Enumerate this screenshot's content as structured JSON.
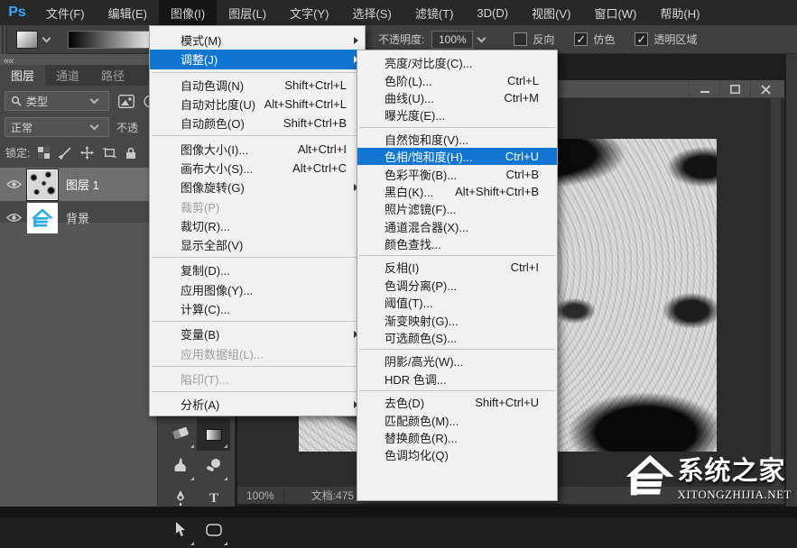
{
  "menu_bar": {
    "logo": "Ps",
    "items": [
      {
        "key": "file",
        "label": "文件(F)"
      },
      {
        "key": "edit",
        "label": "编辑(E)"
      },
      {
        "key": "image",
        "label": "图像(I)",
        "active": true
      },
      {
        "key": "layer",
        "label": "图层(L)"
      },
      {
        "key": "type",
        "label": "文字(Y)"
      },
      {
        "key": "select",
        "label": "选择(S)"
      },
      {
        "key": "filter",
        "label": "滤镜(T)"
      },
      {
        "key": "3d",
        "label": "3D(D)"
      },
      {
        "key": "view",
        "label": "视图(V)"
      },
      {
        "key": "window",
        "label": "窗口(W)"
      },
      {
        "key": "help",
        "label": "帮助(H)"
      }
    ]
  },
  "options_bar": {
    "opacity_label": "不透明度:",
    "opacity_value": "100%",
    "checkboxes": [
      {
        "key": "reverse",
        "label": "反向",
        "checked": false
      },
      {
        "key": "dither",
        "label": "仿色",
        "checked": true
      },
      {
        "key": "transparency",
        "label": "透明区域",
        "checked": true
      }
    ]
  },
  "panels": {
    "tabs": [
      {
        "key": "layers",
        "label": "图层",
        "active": true
      },
      {
        "key": "channels",
        "label": "通道",
        "active": false
      },
      {
        "key": "paths",
        "label": "路径",
        "active": false
      }
    ],
    "filter_label": "类型",
    "blend_mode": "正常",
    "opacity_partial": "不透",
    "lock_label": "锁定:",
    "lock_icons": [
      "lock-transparent-icon",
      "lock-brush-icon",
      "lock-move-icon",
      "lock-artboard-icon",
      "lock-all-icon"
    ],
    "layers": [
      {
        "name": "图层 1",
        "selected": true,
        "thumb": "texture"
      },
      {
        "name": "背景",
        "selected": false,
        "thumb": "logo"
      }
    ]
  },
  "tools": [
    {
      "key": "eraser",
      "selected": false
    },
    {
      "key": "gradient",
      "selected": true
    },
    {
      "key": "smudge",
      "selected": false
    },
    {
      "key": "dodge",
      "selected": false
    },
    {
      "key": "pen",
      "selected": false
    },
    {
      "key": "type",
      "selected": false
    },
    {
      "key": "path-select",
      "selected": false
    },
    {
      "key": "shape",
      "selected": false
    }
  ],
  "image_menu": {
    "items": [
      {
        "key": "mode",
        "label": "模式(M)",
        "submenu": true
      },
      {
        "key": "adjustments",
        "label": "调整(J)",
        "submenu": true,
        "highlighted": true
      },
      {
        "type": "separator"
      },
      {
        "key": "auto-tone",
        "label": "自动色调(N)",
        "shortcut": "Shift+Ctrl+L"
      },
      {
        "key": "auto-contrast",
        "label": "自动对比度(U)",
        "shortcut": "Alt+Shift+Ctrl+L"
      },
      {
        "key": "auto-color",
        "label": "自动颜色(O)",
        "shortcut": "Shift+Ctrl+B"
      },
      {
        "type": "separator"
      },
      {
        "key": "image-size",
        "label": "图像大小(I)...",
        "shortcut": "Alt+Ctrl+I"
      },
      {
        "key": "canvas-size",
        "label": "画布大小(S)...",
        "shortcut": "Alt+Ctrl+C"
      },
      {
        "key": "image-rotation",
        "label": "图像旋转(G)",
        "submenu": true
      },
      {
        "key": "crop",
        "label": "裁剪(P)",
        "disabled": true
      },
      {
        "key": "trim",
        "label": "裁切(R)..."
      },
      {
        "key": "reveal-all",
        "label": "显示全部(V)"
      },
      {
        "type": "separator"
      },
      {
        "key": "duplicate",
        "label": "复制(D)..."
      },
      {
        "key": "apply-image",
        "label": "应用图像(Y)..."
      },
      {
        "key": "calculations",
        "label": "计算(C)..."
      },
      {
        "type": "separator"
      },
      {
        "key": "variables",
        "label": "变量(B)",
        "submenu": true
      },
      {
        "key": "apply-data-set",
        "label": "应用数据组(L)...",
        "disabled": true
      },
      {
        "type": "separator"
      },
      {
        "key": "trap",
        "label": "陷印(T)...",
        "disabled": true
      },
      {
        "type": "separator"
      },
      {
        "key": "analysis",
        "label": "分析(A)",
        "submenu": true
      }
    ]
  },
  "adjust_submenu": {
    "items": [
      {
        "key": "brightness-contrast",
        "label": "亮度/对比度(C)..."
      },
      {
        "key": "levels",
        "label": "色阶(L)...",
        "shortcut": "Ctrl+L"
      },
      {
        "key": "curves",
        "label": "曲线(U)...",
        "shortcut": "Ctrl+M"
      },
      {
        "key": "exposure",
        "label": "曝光度(E)..."
      },
      {
        "type": "separator"
      },
      {
        "key": "vibrance",
        "label": "自然饱和度(V)..."
      },
      {
        "key": "hue-saturation",
        "label": "色相/饱和度(H)...",
        "shortcut": "Ctrl+U",
        "highlighted": true
      },
      {
        "key": "color-balance",
        "label": "色彩平衡(B)...",
        "shortcut": "Ctrl+B"
      },
      {
        "key": "black-white",
        "label": "黑白(K)...",
        "shortcut": "Alt+Shift+Ctrl+B"
      },
      {
        "key": "photo-filter",
        "label": "照片滤镜(F)..."
      },
      {
        "key": "channel-mixer",
        "label": "通道混合器(X)..."
      },
      {
        "key": "color-lookup",
        "label": "颜色查找..."
      },
      {
        "type": "separator"
      },
      {
        "key": "invert",
        "label": "反相(I)",
        "shortcut": "Ctrl+I"
      },
      {
        "key": "posterize",
        "label": "色调分离(P)..."
      },
      {
        "key": "threshold",
        "label": "阈值(T)..."
      },
      {
        "key": "gradient-map",
        "label": "渐变映射(G)..."
      },
      {
        "key": "selective-color",
        "label": "可选颜色(S)..."
      },
      {
        "type": "separator"
      },
      {
        "key": "shadows-highlights",
        "label": "阴影/高光(W)..."
      },
      {
        "key": "hdr-toning",
        "label": "HDR 色调..."
      },
      {
        "type": "separator"
      },
      {
        "key": "desaturate",
        "label": "去色(D)",
        "shortcut": "Shift+Ctrl+U"
      },
      {
        "key": "match-color",
        "label": "匹配颜色(M)..."
      },
      {
        "key": "replace-color",
        "label": "替换颜色(R)..."
      },
      {
        "key": "equalize",
        "label": "色调均化(Q)"
      }
    ]
  },
  "document": {
    "zoom": "100%",
    "doc_info": "文档:475"
  },
  "watermark": {
    "title": "系统之家",
    "subtitle": "XITONGZHIJIA.NET"
  },
  "colors": {
    "menu_highlight": "#1176d2",
    "ps_logo_blue": "#31a8ff",
    "bg_thumb_blue": "#29abe2"
  }
}
